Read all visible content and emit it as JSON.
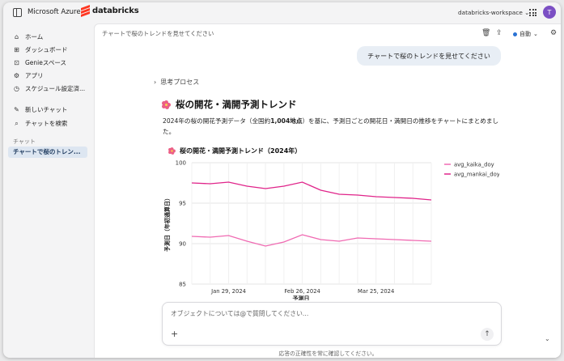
{
  "topbar": {
    "brand_ms": "Microsoft Azure",
    "brand_db": "databricks",
    "workspace": "databricks-workspace ⌄",
    "avatar_initial": "T"
  },
  "sidebar": {
    "items": [
      {
        "label": "ホーム",
        "icon": "home-icon"
      },
      {
        "label": "ダッシュボード",
        "icon": "dashboard-icon"
      },
      {
        "label": "Genieスペース",
        "icon": "genie-icon"
      },
      {
        "label": "アプリ",
        "icon": "apps-icon"
      },
      {
        "label": "スケジュール設定済...",
        "icon": "schedule-icon"
      },
      {
        "label": "新しいチャット",
        "icon": "pencil-icon"
      },
      {
        "label": "チャットを検索",
        "icon": "search-icon"
      }
    ],
    "section_label": "チャット",
    "active_chat": "チャートで桜のトレン..."
  },
  "header": {
    "breadcrumb": "チャートで桜のトレンドを見せてください",
    "mode_label": "自動"
  },
  "conversation": {
    "user_message": "チャートで桜のトレンドを見せてください",
    "thinking_label": "思考プロセス",
    "answer_title": "桜の開花・満開予測トレンド",
    "answer_body_pre": "2024年の桜の開花予測データ（全国約",
    "answer_body_bold": "1,004地点",
    "answer_body_post": "）を基に、予測日ごとの開花日・満開日の推移をチャートにまとめました。"
  },
  "chart_data": {
    "type": "line",
    "title": "桜の開花・満開予測トレンド（2024年）",
    "xlabel": "予測日",
    "ylabel": "予測日（年初通算日）",
    "ylim": [
      85,
      100
    ],
    "yticks": [
      85,
      90,
      95,
      100
    ],
    "xticks": [
      "Jan 29, 2024",
      "Feb 26, 2024",
      "Mar 25, 2024"
    ],
    "x": [
      "2024-01-15",
      "2024-01-22",
      "2024-01-29",
      "2024-02-05",
      "2024-02-12",
      "2024-02-19",
      "2024-02-26",
      "2024-03-04",
      "2024-03-11",
      "2024-03-18",
      "2024-03-25",
      "2024-04-01",
      "2024-04-08",
      "2024-04-15"
    ],
    "series": [
      {
        "name": "avg_kaika_doy",
        "color": "#f06ab2",
        "values": [
          90.9,
          90.8,
          91.0,
          90.3,
          89.7,
          90.2,
          91.1,
          90.5,
          90.3,
          90.7,
          90.6,
          90.5,
          90.4,
          90.3
        ]
      },
      {
        "name": "avg_mankai_doy",
        "color": "#e0248a",
        "values": [
          97.5,
          97.4,
          97.6,
          97.1,
          96.8,
          97.1,
          97.6,
          96.6,
          96.1,
          96.0,
          95.8,
          95.7,
          95.6,
          95.4
        ]
      }
    ],
    "grid": true,
    "legend_position": "right"
  },
  "composer": {
    "placeholder": "オブジェクトについては@で質問してください...",
    "disclaimer": "応答の正確性を常に確認してください。"
  }
}
